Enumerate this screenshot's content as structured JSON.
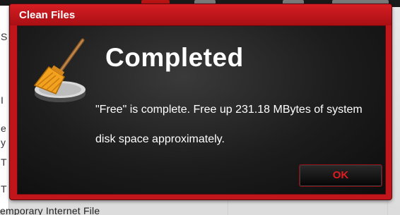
{
  "background": {
    "bottom_text": "emporary Internet File",
    "left_chars": [
      "S",
      "I",
      "e",
      "y",
      "T",
      "T"
    ]
  },
  "dialog": {
    "title": "Clean Files",
    "heading": "Completed",
    "message": "\"Free\" is complete. Free up  231.18 MBytes of system disk space approximately.",
    "ok_label": "OK",
    "icon": "broom-disk-icon"
  },
  "colors": {
    "accent_red": "#c0161b",
    "body_dark": "#1c1c1c",
    "ok_text": "#e01b1f"
  }
}
